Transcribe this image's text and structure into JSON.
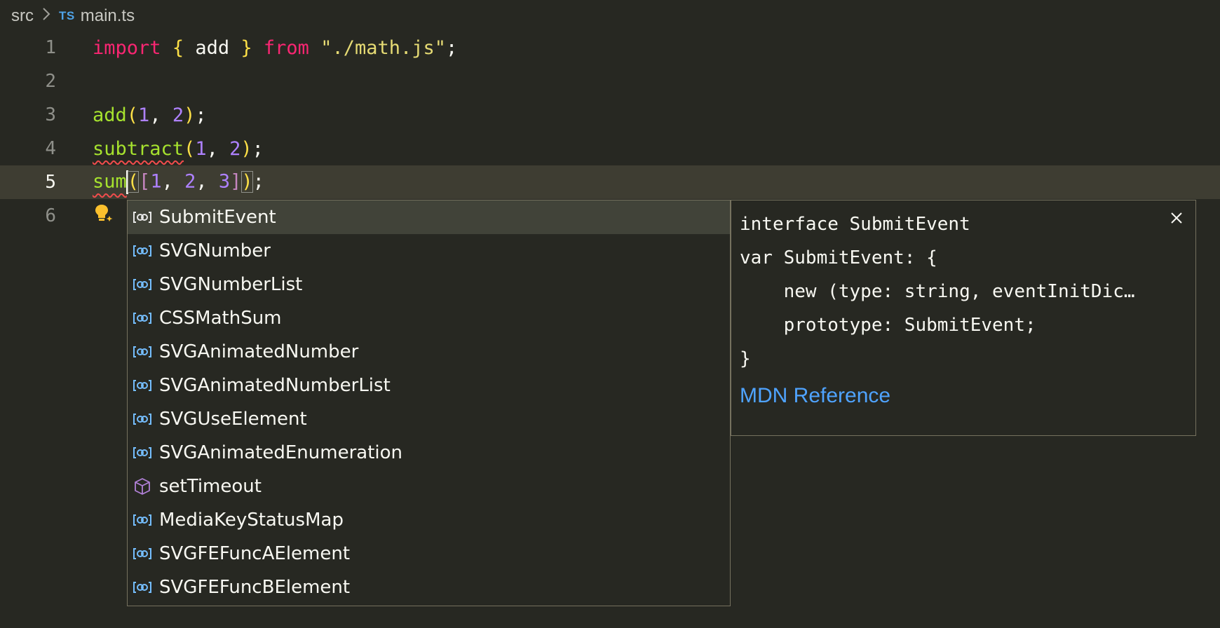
{
  "breadcrumb": {
    "folder": "src",
    "lang_badge": "TS",
    "file": "main.ts"
  },
  "editor": {
    "line_numbers": [
      "1",
      "2",
      "3",
      "4",
      "5",
      "6"
    ],
    "line1": {
      "import": "import",
      "lb": "{",
      "name": " add ",
      "rb": "}",
      "from": "from",
      "path": "\"./math.js\"",
      "semi": ";"
    },
    "line3": {
      "fn": "add",
      "lp": "(",
      "a": "1",
      "comma": ", ",
      "b": "2",
      "rp": ")",
      "semi": ";"
    },
    "line4": {
      "fn": "subtract",
      "lp": "(",
      "a": "1",
      "comma": ", ",
      "b": "2",
      "rp": ")",
      "semi": ";"
    },
    "line5": {
      "fn": "sum",
      "lp": "(",
      "lb": "[",
      "a": "1",
      "c1": ", ",
      "b": "2",
      "c2": ", ",
      "c": "3",
      "rb": "]",
      "rp": ")",
      "semi": ";"
    }
  },
  "suggestions": [
    {
      "label": "SubmitEvent",
      "icon": "interface-icon",
      "selected": true
    },
    {
      "label": "SVGNumber",
      "icon": "interface-icon"
    },
    {
      "label": "SVGNumberList",
      "icon": "interface-icon"
    },
    {
      "label": "CSSMathSum",
      "icon": "interface-icon"
    },
    {
      "label": "SVGAnimatedNumber",
      "icon": "interface-icon"
    },
    {
      "label": "SVGAnimatedNumberList",
      "icon": "interface-icon"
    },
    {
      "label": "SVGUseElement",
      "icon": "interface-icon"
    },
    {
      "label": "SVGAnimatedEnumeration",
      "icon": "interface-icon"
    },
    {
      "label": "setTimeout",
      "icon": "method-cube-icon"
    },
    {
      "label": "MediaKeyStatusMap",
      "icon": "interface-icon"
    },
    {
      "label": "SVGFEFuncAElement",
      "icon": "interface-icon"
    },
    {
      "label": "SVGFEFuncBElement",
      "icon": "interface-icon"
    }
  ],
  "details": {
    "lines": [
      "interface SubmitEvent",
      "var SubmitEvent: {",
      "    new (type: string, eventInitDic…",
      "    prototype: SubmitEvent;",
      "}"
    ],
    "link": "MDN Reference",
    "close_icon": "close-icon"
  },
  "colors": {
    "background": "#272822",
    "keyword": "#f92672",
    "function": "#a6e22e",
    "number": "#ae81ff",
    "string": "#e6db74",
    "link": "#4fa3ff",
    "error": "#f14c4c",
    "icon_interface": "#75beff",
    "icon_method": "#b180d7"
  }
}
